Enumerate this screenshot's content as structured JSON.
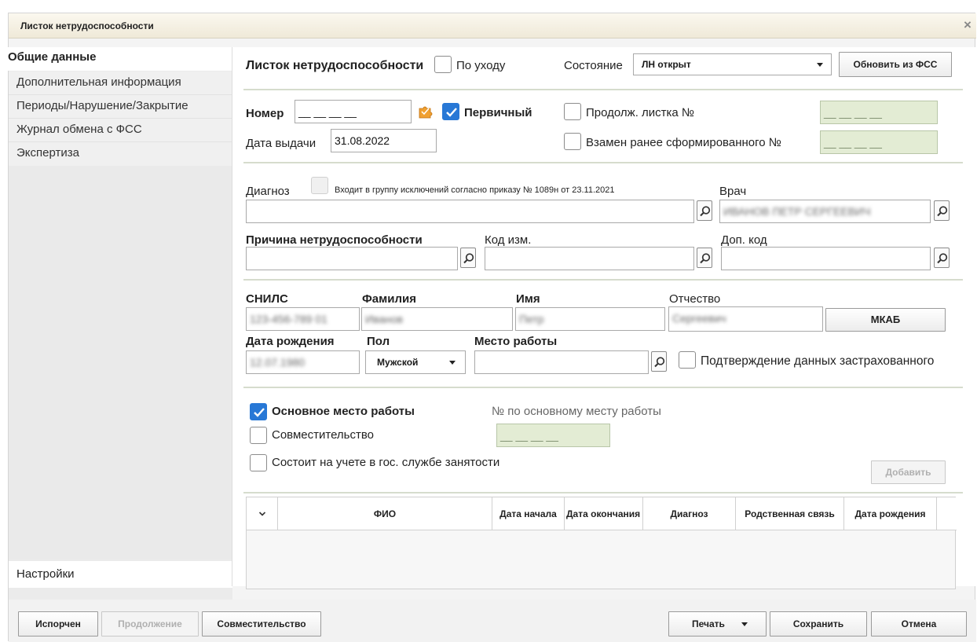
{
  "window": {
    "title": "Листок нетрудоспособности",
    "close": "×"
  },
  "sidebar": {
    "items": [
      {
        "label": "Общие данные"
      },
      {
        "label": "Дополнительная информация"
      },
      {
        "label": "Периоды/Нарушение/Закрытие"
      },
      {
        "label": "Журнал обмена с ФСС"
      },
      {
        "label": "Экспертиза"
      }
    ],
    "settings": "Настройки"
  },
  "header": {
    "title": "Листок нетрудоспособности",
    "care_label": "По уходу",
    "state_label": "Состояние",
    "state_value": "ЛН открыт",
    "update_button": "Обновить из ФСС"
  },
  "numbers": {
    "number_label": "Номер",
    "number_value": "__ __ __ __",
    "primary_label": "Первичный",
    "issue_date_label": "Дата выдачи",
    "issue_date_value": "31.08.2022",
    "continuation_label": "Продолж. листка №",
    "continuation_value": "__ __ __ __",
    "instead_label": "Взамен ранее сформированного №",
    "instead_value": "__ __ __ __"
  },
  "diagnosis": {
    "label": "Диагноз",
    "exception_label": "Входит в группу исключений согласно приказу № 1089н от 23.11.2021",
    "doctor_label": "Врач",
    "doctor_value": "ИВАНОВ ПЕТР СЕРГЕЕВИЧ",
    "reason_label": "Причина нетрудоспособности",
    "change_code_label": "Код изм.",
    "extra_code_label": "Доп. код"
  },
  "patient": {
    "snils_label": "СНИЛС",
    "snils_value": "123-456-789 01",
    "surname_label": "Фамилия",
    "surname_value": "Иванов",
    "name_label": "Имя",
    "name_value": "Петр",
    "patronymic_label": "Отчество",
    "patronymic_value": "Сергеевич",
    "mkab_button": "МКАБ",
    "birth_label": "Дата рождения",
    "birth_value": "12.07.1980",
    "sex_label": "Пол",
    "sex_value": "Мужской",
    "work_label": "Место работы",
    "confirm_label": "Подтверждение данных застрахованного"
  },
  "employment": {
    "main_work_label": "Основное место работы",
    "main_work_no_label": "№ по основному месту работы",
    "combination_label": "Совместительство",
    "combination_value": "__ __ __ __",
    "employment_service_label": "Состоит на учете в гос. службе занятости",
    "add_button": "Добавить"
  },
  "grid": {
    "columns": [
      "ФИО",
      "Дата начала",
      "Дата окончания",
      "Диагноз",
      "Родственная связь",
      "Дата рождения"
    ]
  },
  "footer": {
    "spoiled": "Испорчен",
    "continuation": "Продолжение",
    "combination": "Совместительство",
    "print": "Печать",
    "save": "Сохранить",
    "cancel": "Отмена"
  },
  "colors": {
    "accent": "#2878d6",
    "title_bg": "#f4efe0",
    "readonly_bg": "#e3ecd4"
  }
}
